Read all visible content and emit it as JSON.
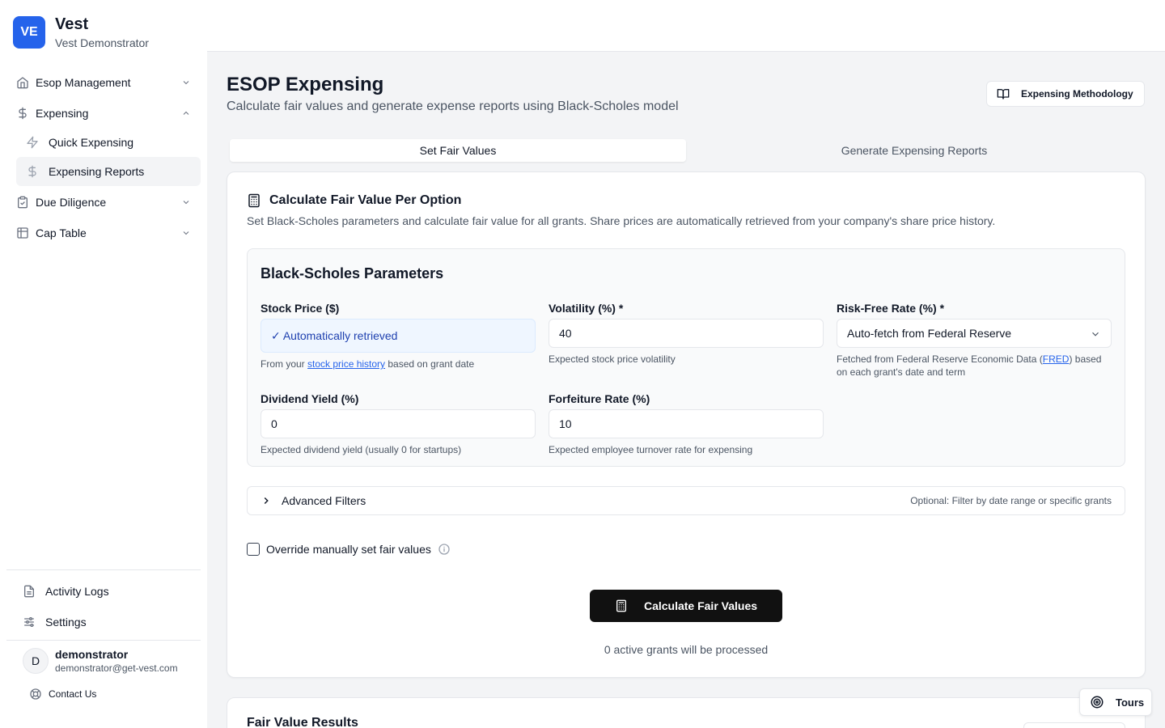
{
  "brand": {
    "logo": "VE",
    "name": "Vest",
    "subtitle": "Vest Demonstrator"
  },
  "nav": {
    "items": [
      {
        "label": "Esop Management",
        "icon": "home-icon",
        "expanded": false
      },
      {
        "label": "Expensing",
        "icon": "dollar-icon",
        "expanded": true,
        "children": [
          {
            "label": "Quick Expensing",
            "icon": "zap-icon",
            "active": false
          },
          {
            "label": "Expensing Reports",
            "icon": "dollar-icon",
            "active": true
          }
        ]
      },
      {
        "label": "Due Diligence",
        "icon": "clipboard-check-icon",
        "expanded": false
      },
      {
        "label": "Cap Table",
        "icon": "table-icon",
        "expanded": false
      }
    ],
    "bottom": [
      {
        "label": "Activity Logs",
        "icon": "file-text-icon"
      },
      {
        "label": "Settings",
        "icon": "sliders-icon"
      }
    ]
  },
  "user": {
    "initial": "D",
    "name": "demonstrator",
    "email": "demonstrator@get-vest.com"
  },
  "contact": {
    "label": "Contact Us"
  },
  "header": {
    "title": "ESOP Expensing",
    "subtitle": "Calculate fair values and generate expense reports using Black-Scholes model",
    "methodology_button": "Expensing Methodology"
  },
  "tabs": [
    {
      "label": "Set Fair Values",
      "active": true
    },
    {
      "label": "Generate Expensing Reports",
      "active": false
    }
  ],
  "calc_card": {
    "title": "Calculate Fair Value Per Option",
    "description": "Set Black-Scholes parameters and calculate fair value for all grants. Share prices are automatically retrieved from your company's share price history.",
    "params_title": "Black-Scholes Parameters",
    "stock_price": {
      "label": "Stock Price ($)",
      "value": "✓ Automatically retrieved",
      "help_prefix": "From your ",
      "help_link": "stock price history",
      "help_suffix": " based on grant date"
    },
    "volatility": {
      "label": "Volatility (%) *",
      "value": "40",
      "help": "Expected stock price volatility"
    },
    "risk_free": {
      "label": "Risk-Free Rate (%) *",
      "value": "Auto-fetch from Federal Reserve",
      "help_prefix": "Fetched from Federal Reserve Economic Data (",
      "help_link": "FRED",
      "help_suffix": ") based on each grant's date and term"
    },
    "dividend": {
      "label": "Dividend Yield (%)",
      "value": "0",
      "help": "Expected dividend yield (usually 0 for startups)"
    },
    "forfeiture": {
      "label": "Forfeiture Rate (%)",
      "value": "10",
      "help": "Expected employee turnover rate for expensing"
    },
    "advanced": {
      "label": "Advanced Filters",
      "hint": "Optional: Filter by date range or specific grants"
    },
    "override": {
      "label": "Override manually set fair values",
      "checked": false
    },
    "calculate_button": "Calculate Fair Values",
    "process_note": "0 active grants will be processed"
  },
  "results_card": {
    "title": "Fair Value Results"
  },
  "tours_button": "Tours",
  "colors": {
    "brand": "#2563eb",
    "primary_button": "#111111",
    "auto_field_bg": "#eff6ff",
    "link": "#2563eb"
  }
}
